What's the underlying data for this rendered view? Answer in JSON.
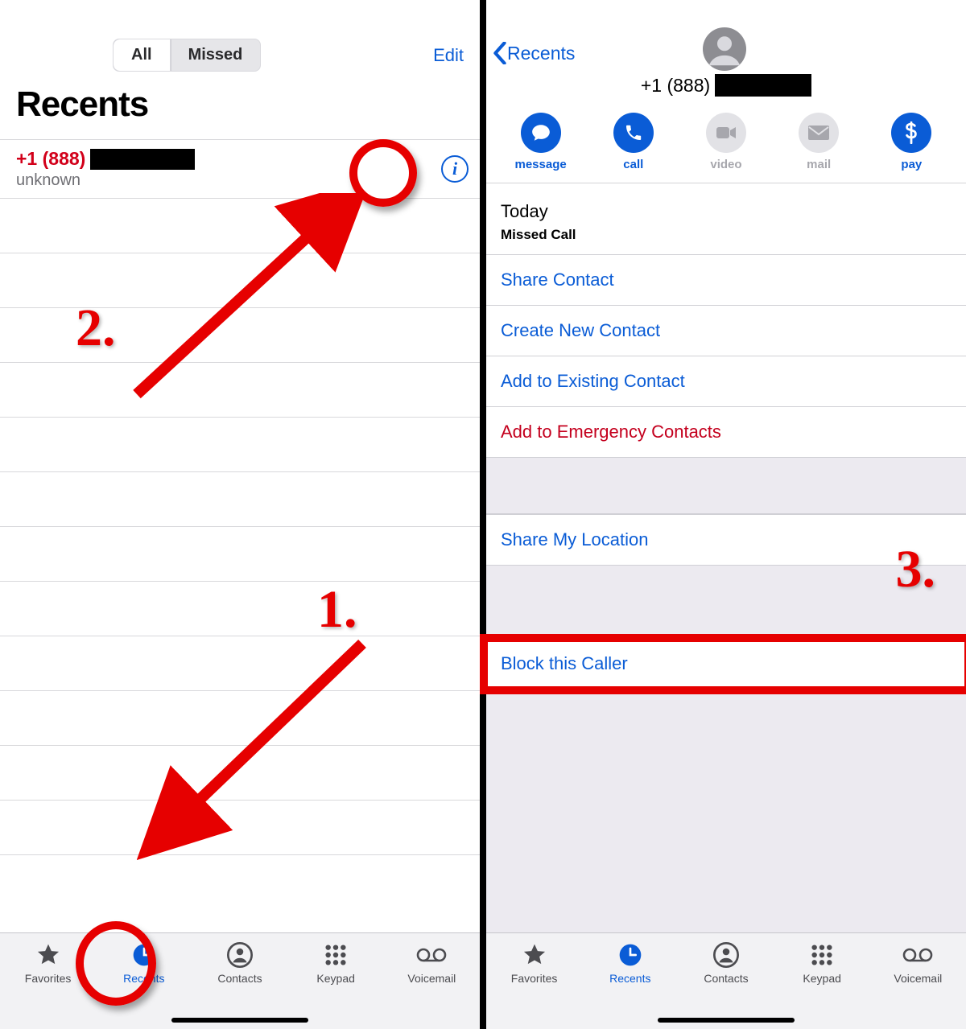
{
  "left": {
    "segment": {
      "all": "All",
      "missed": "Missed"
    },
    "edit": "Edit",
    "title": "Recents",
    "row": {
      "number_prefix": "+1 (888)",
      "sub": "unknown",
      "info_glyph": "i"
    }
  },
  "tabs": {
    "favorites": "Favorites",
    "recents": "Recents",
    "contacts": "Contacts",
    "keypad": "Keypad",
    "voicemail": "Voicemail"
  },
  "right": {
    "back": "Recents",
    "phone_prefix": "+1 (888)",
    "actions": {
      "message": "message",
      "call": "call",
      "video": "video",
      "mail": "mail",
      "pay": "pay"
    },
    "today": "Today",
    "today_sub": "Missed Call",
    "opts": {
      "share_contact": "Share Contact",
      "create_new": "Create New Contact",
      "add_existing": "Add to Existing Contact",
      "add_emergency": "Add to Emergency Contacts",
      "share_location": "Share My Location",
      "block": "Block this Caller"
    }
  },
  "annotations": {
    "n1": "1.",
    "n2": "2.",
    "n3": "3."
  },
  "colors": {
    "ios_blue": "#0a5cd6",
    "anno_red": "#e60000",
    "miss_red": "#d2001a"
  }
}
